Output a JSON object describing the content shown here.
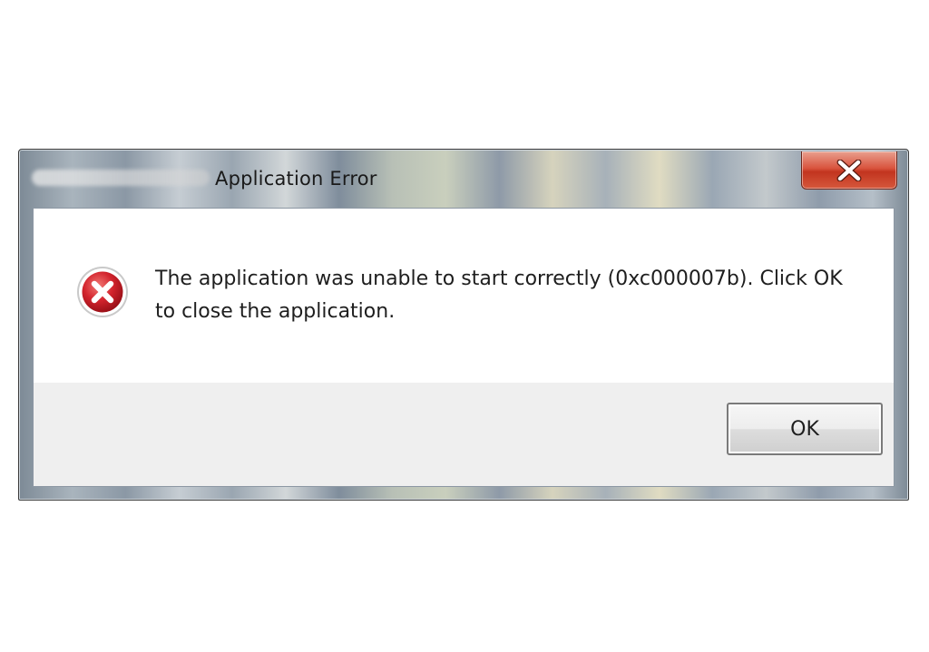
{
  "window": {
    "title": "Application Error",
    "title_prefix": "deadrising3.exe -"
  },
  "title_bar": {
    "close_icon": "close-x-icon"
  },
  "message": {
    "icon": "error-icon",
    "text": "The application was unable to start correctly (0xc000007b). Click OK to close the application."
  },
  "buttons": {
    "ok_label": "OK"
  },
  "colors": {
    "close_button": "#d9543e",
    "error_icon": "#d3242d",
    "button_area": "#efefef"
  }
}
